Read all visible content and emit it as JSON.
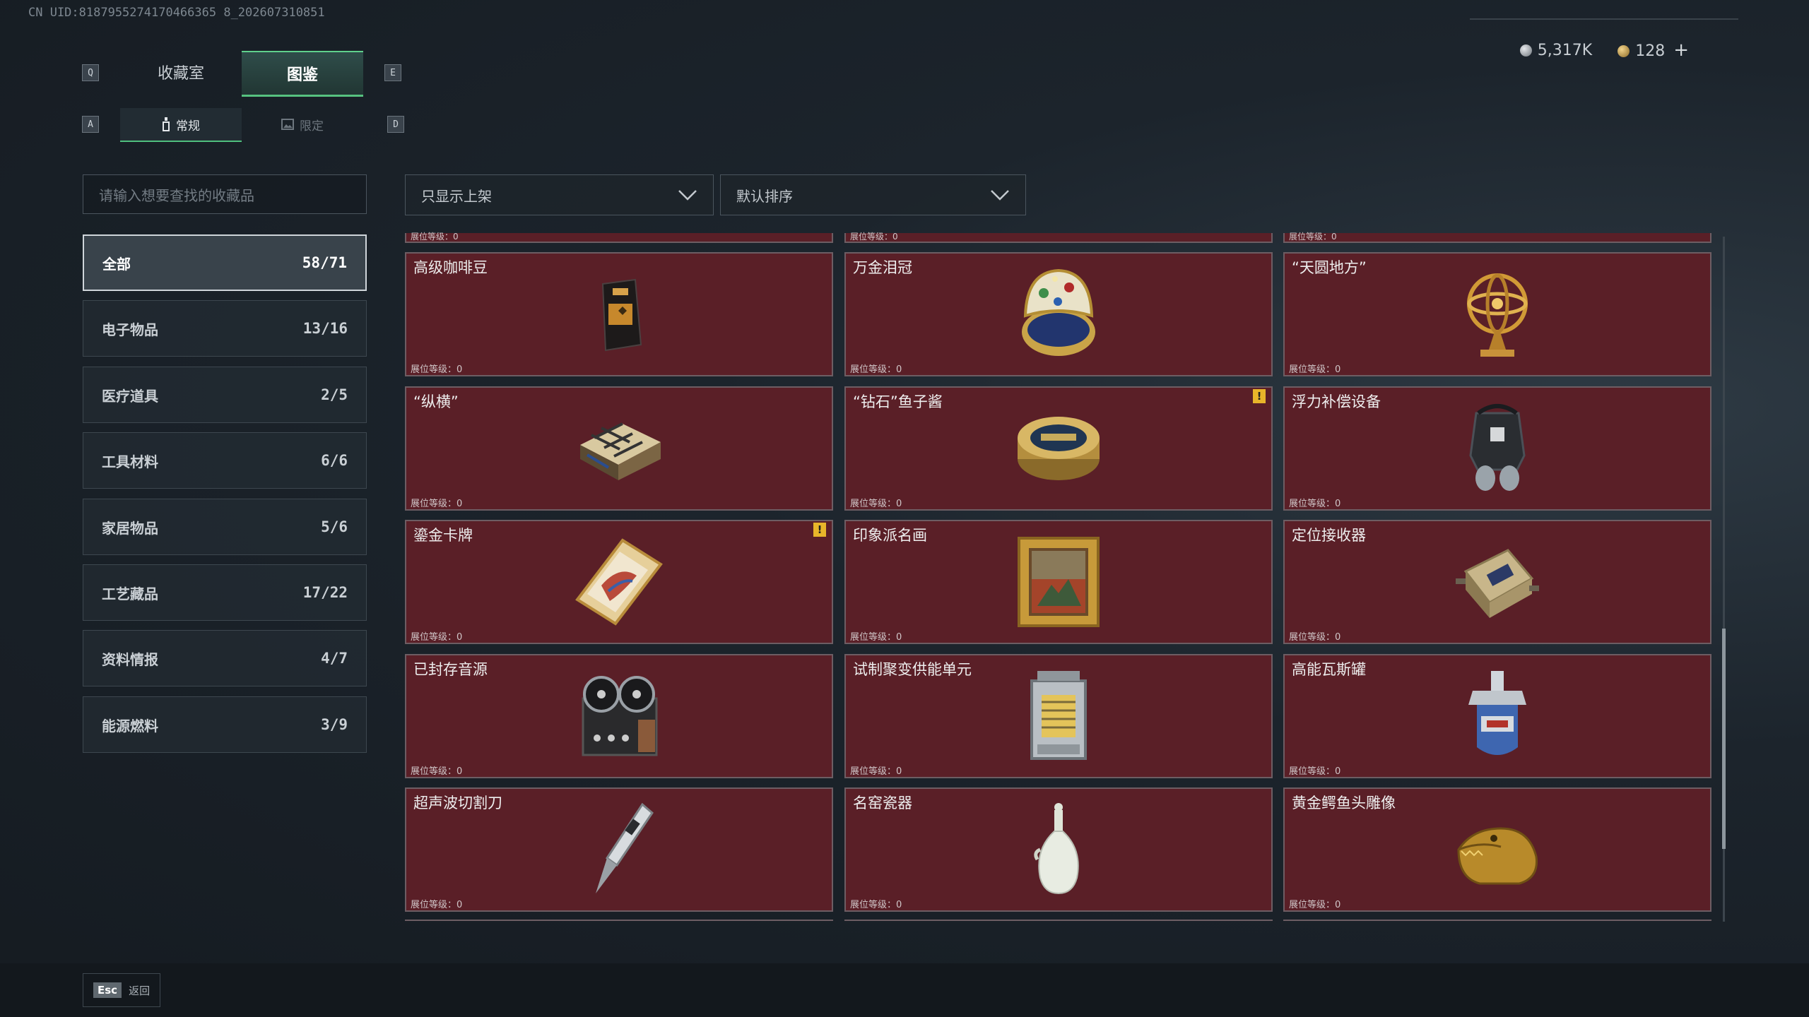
{
  "uid": "CN UID:8187955274170466365 8_202607310851",
  "keys": {
    "q": "Q",
    "e": "E",
    "a": "A",
    "d": "D"
  },
  "tabs": [
    {
      "label": "收藏室"
    },
    {
      "label": "图鉴"
    }
  ],
  "subtabs": [
    {
      "label": "常规"
    },
    {
      "label": "限定"
    }
  ],
  "currency": {
    "silver": "5,317K",
    "gold": "128",
    "plus": "+"
  },
  "search": {
    "placeholder": "请输入想要查找的收藏品"
  },
  "filters": {
    "shelf": "只显示上架",
    "sort": "默认排序"
  },
  "categories": [
    {
      "name": "全部",
      "count": "58/71"
    },
    {
      "name": "电子物品",
      "count": "13/16"
    },
    {
      "name": "医疗道具",
      "count": "2/5"
    },
    {
      "name": "工具材料",
      "count": "6/6"
    },
    {
      "name": "家居物品",
      "count": "5/6"
    },
    {
      "name": "工艺藏品",
      "count": "17/22"
    },
    {
      "name": "资料情报",
      "count": "4/7"
    },
    {
      "name": "能源燃料",
      "count": "3/9"
    }
  ],
  "level_label": "展位等级：0",
  "items": [
    {
      "name": "高级咖啡豆",
      "icon": "coffee-bag-icon"
    },
    {
      "name": "万金泪冠",
      "icon": "jeweled-egg-icon"
    },
    {
      "name": "“天圆地方”",
      "icon": "armillary-sphere-icon"
    },
    {
      "name": "“纵横”",
      "icon": "chess-box-icon"
    },
    {
      "name": "“钻石”鱼子酱",
      "icon": "caviar-tin-icon",
      "warn": "!"
    },
    {
      "name": "浮力补偿设备",
      "icon": "buoyancy-device-icon"
    },
    {
      "name": "鎏金卡牌",
      "icon": "gilded-card-icon",
      "warn": "!"
    },
    {
      "name": "印象派名画",
      "icon": "framed-painting-icon"
    },
    {
      "name": "定位接收器",
      "icon": "receiver-device-icon"
    },
    {
      "name": "已封存音源",
      "icon": "reel-recorder-icon"
    },
    {
      "name": "试制聚变供能单元",
      "icon": "fusion-unit-icon"
    },
    {
      "name": "高能瓦斯罐",
      "icon": "gas-canister-icon"
    },
    {
      "name": "超声波切割刀",
      "icon": "ultrasonic-knife-icon"
    },
    {
      "name": "名窑瓷器",
      "icon": "porcelain-vase-icon"
    },
    {
      "name": "黄金鳄鱼头雕像",
      "icon": "gold-crocodile-icon"
    }
  ],
  "footer": {
    "esc": "Esc",
    "back": "返回"
  }
}
